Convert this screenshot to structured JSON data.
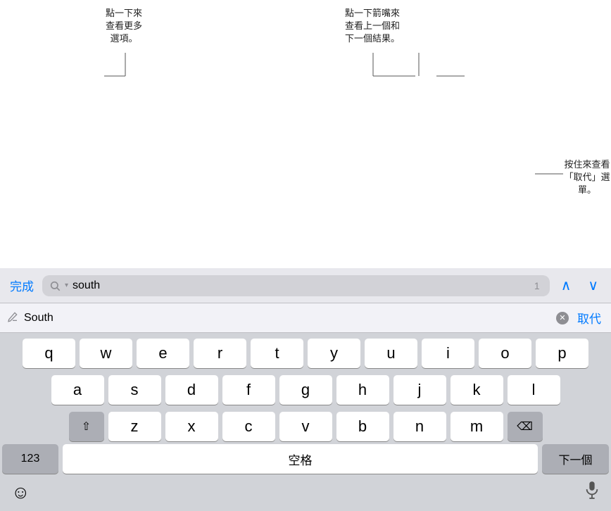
{
  "callouts": {
    "top_left": {
      "lines": [
        "點一下來",
        "查看更多",
        "選項。"
      ]
    },
    "top_right": {
      "lines": [
        "點一下箭嘴來",
        "查看上一個和",
        "下一個結果。"
      ]
    },
    "right": {
      "lines": [
        "按住來查看",
        "「取代」選單。"
      ]
    }
  },
  "findbar": {
    "done_label": "完成",
    "search_value": "south",
    "count": "1",
    "nav_up": "^",
    "nav_down": "v"
  },
  "replacebar": {
    "placeholder": "South",
    "replace_label": "取代"
  },
  "keyboard": {
    "row1": [
      "q",
      "w",
      "e",
      "r",
      "t",
      "y",
      "u",
      "i",
      "o",
      "p"
    ],
    "row2": [
      "a",
      "s",
      "d",
      "f",
      "g",
      "h",
      "j",
      "k",
      "l"
    ],
    "row3": [
      "z",
      "x",
      "c",
      "v",
      "b",
      "n",
      "m"
    ],
    "bottom": {
      "num_label": "123",
      "space_label": "空格",
      "next_label": "下一個"
    }
  },
  "icons": {
    "search": "🔍",
    "pencil": "✏️",
    "emoji": "😊",
    "mic": "🎤",
    "shift": "⇧",
    "delete": "⌫",
    "clear": "✕"
  }
}
